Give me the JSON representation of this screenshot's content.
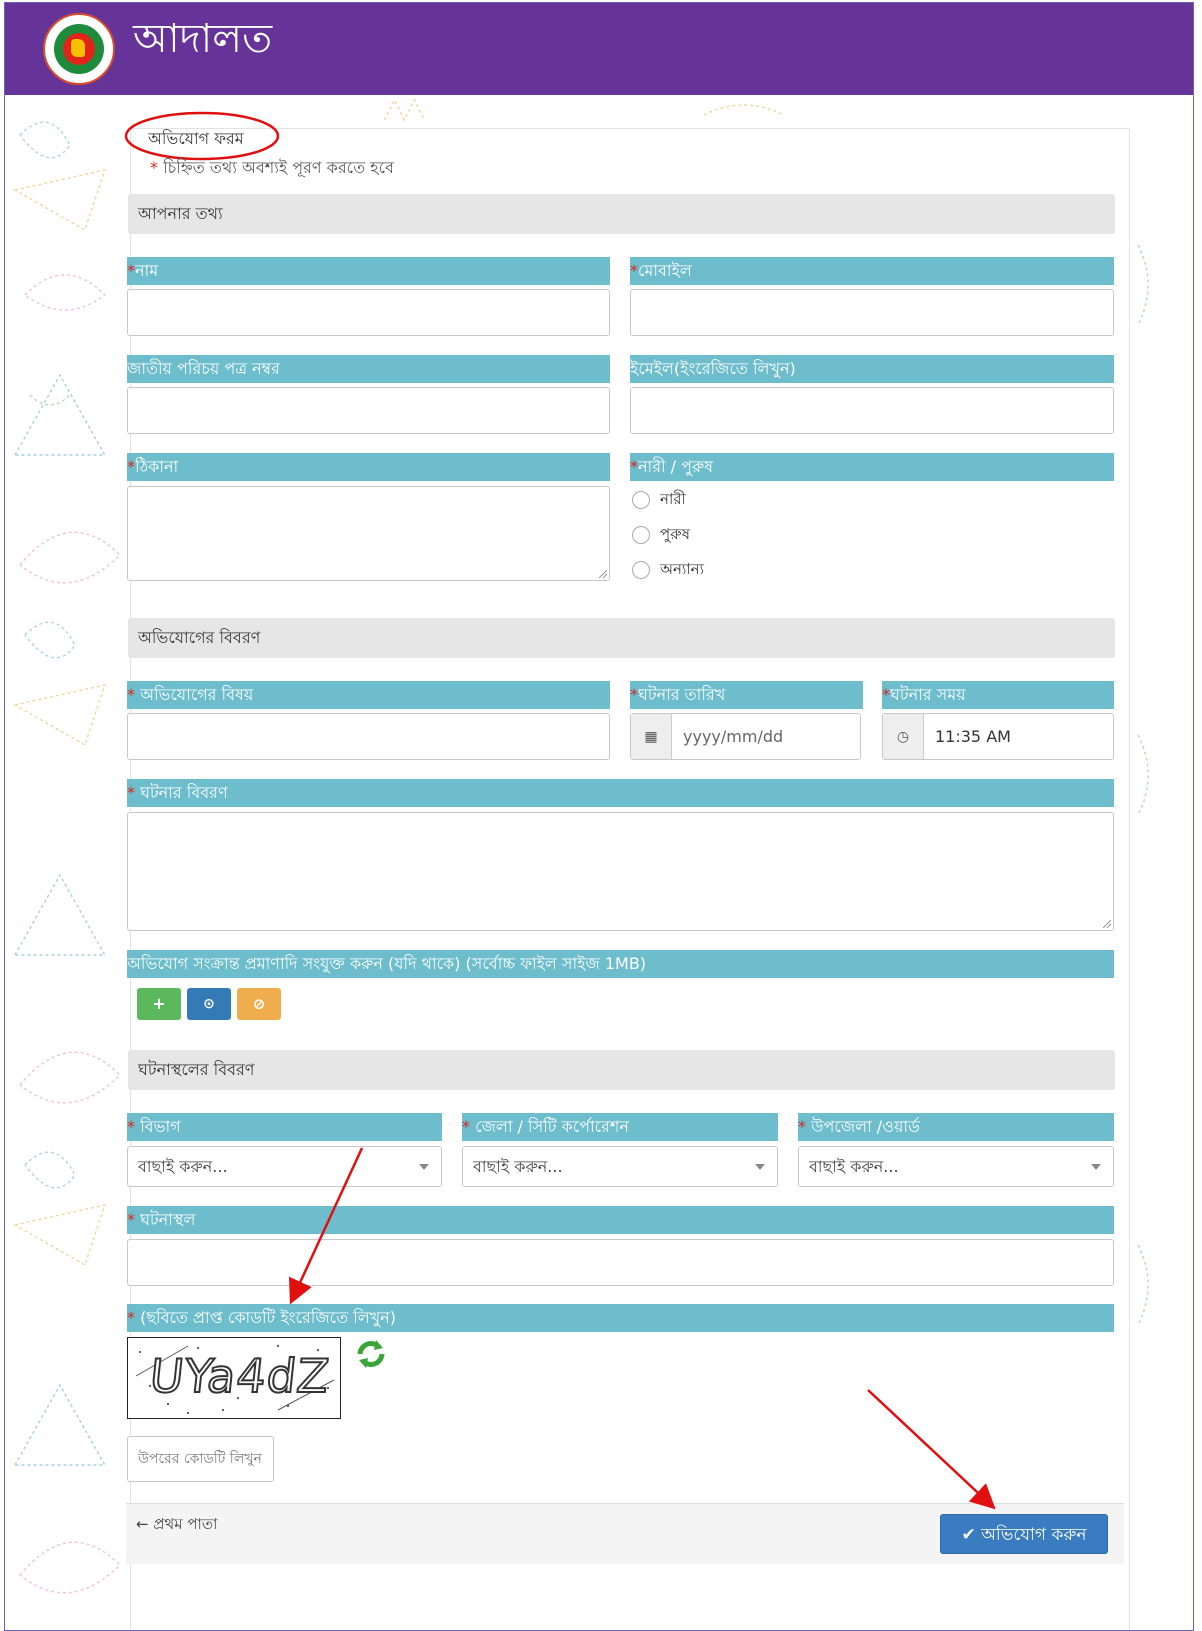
{
  "header": {
    "title": "আদালত",
    "logo": "bangladesh-government-seal"
  },
  "form": {
    "title": "অভিযোগ ফরম",
    "required_mark": "*",
    "required_note": "চিহ্নিত তথ্য অবশ্যই পূরণ করতে হবে"
  },
  "sections": {
    "personal": "আপনার তথ্য",
    "complaint": "অভিযোগের বিবরণ",
    "location": "ঘটনাস্থলের বিবরণ"
  },
  "fields": {
    "name": "নাম",
    "mobile": "মোবাইল",
    "nid": "জাতীয় পরিচয় পত্র নম্বর",
    "email": "ইমেইল(ইংরেজিতে লিখুন)",
    "address": "ঠিকানা",
    "gender": "নারী / পুরুষ",
    "subject": " অভিযোগের বিষয়",
    "incident_date": "ঘটনার তারিখ",
    "incident_time": "ঘটনার সময়",
    "incident_desc": " ঘটনার বিবরণ",
    "attachments": "অভিযোগ সংক্রান্ত প্রমাণাদি সংযুক্ত করুন (যদি থাকে) (সর্বোচ্চ ফাইল সাইজ 1MB)",
    "division": " বিভাগ",
    "district": " জেলা / সিটি কর্পোরেশন",
    "upazila": " উপজেলা /ওয়ার্ড",
    "place": " ঘটনাস্থল",
    "captcha": " (ছবিতে প্রাপ্ত কোডটি ইংরেজিতে লিখুন)"
  },
  "gender_options": [
    "নারী",
    "পুরুষ",
    "অন্যান্য"
  ],
  "date_placeholder": "yyyy/mm/dd",
  "time_value": "11:35 AM",
  "select_placeholder": "বাছাই করুন...",
  "captcha_text": "UYa4dZ",
  "captcha_input_placeholder": "উপরের কোডটি লিখুন",
  "attachment_buttons": {
    "add": "+",
    "upload": "⊙",
    "cancel": "⊘"
  },
  "footer": {
    "back": "← প্রথম পাতা",
    "submit": "অভিযোগ করুন",
    "submit_icon": "✔"
  },
  "colors": {
    "header": "#663399",
    "label_bar": "#6dbdcd",
    "section_bg": "#e6e6e6",
    "submit": "#3a7cc0",
    "add": "#5cb85c",
    "upload": "#337ab7",
    "cancel": "#f0ad4e",
    "required": "#d9281f"
  }
}
